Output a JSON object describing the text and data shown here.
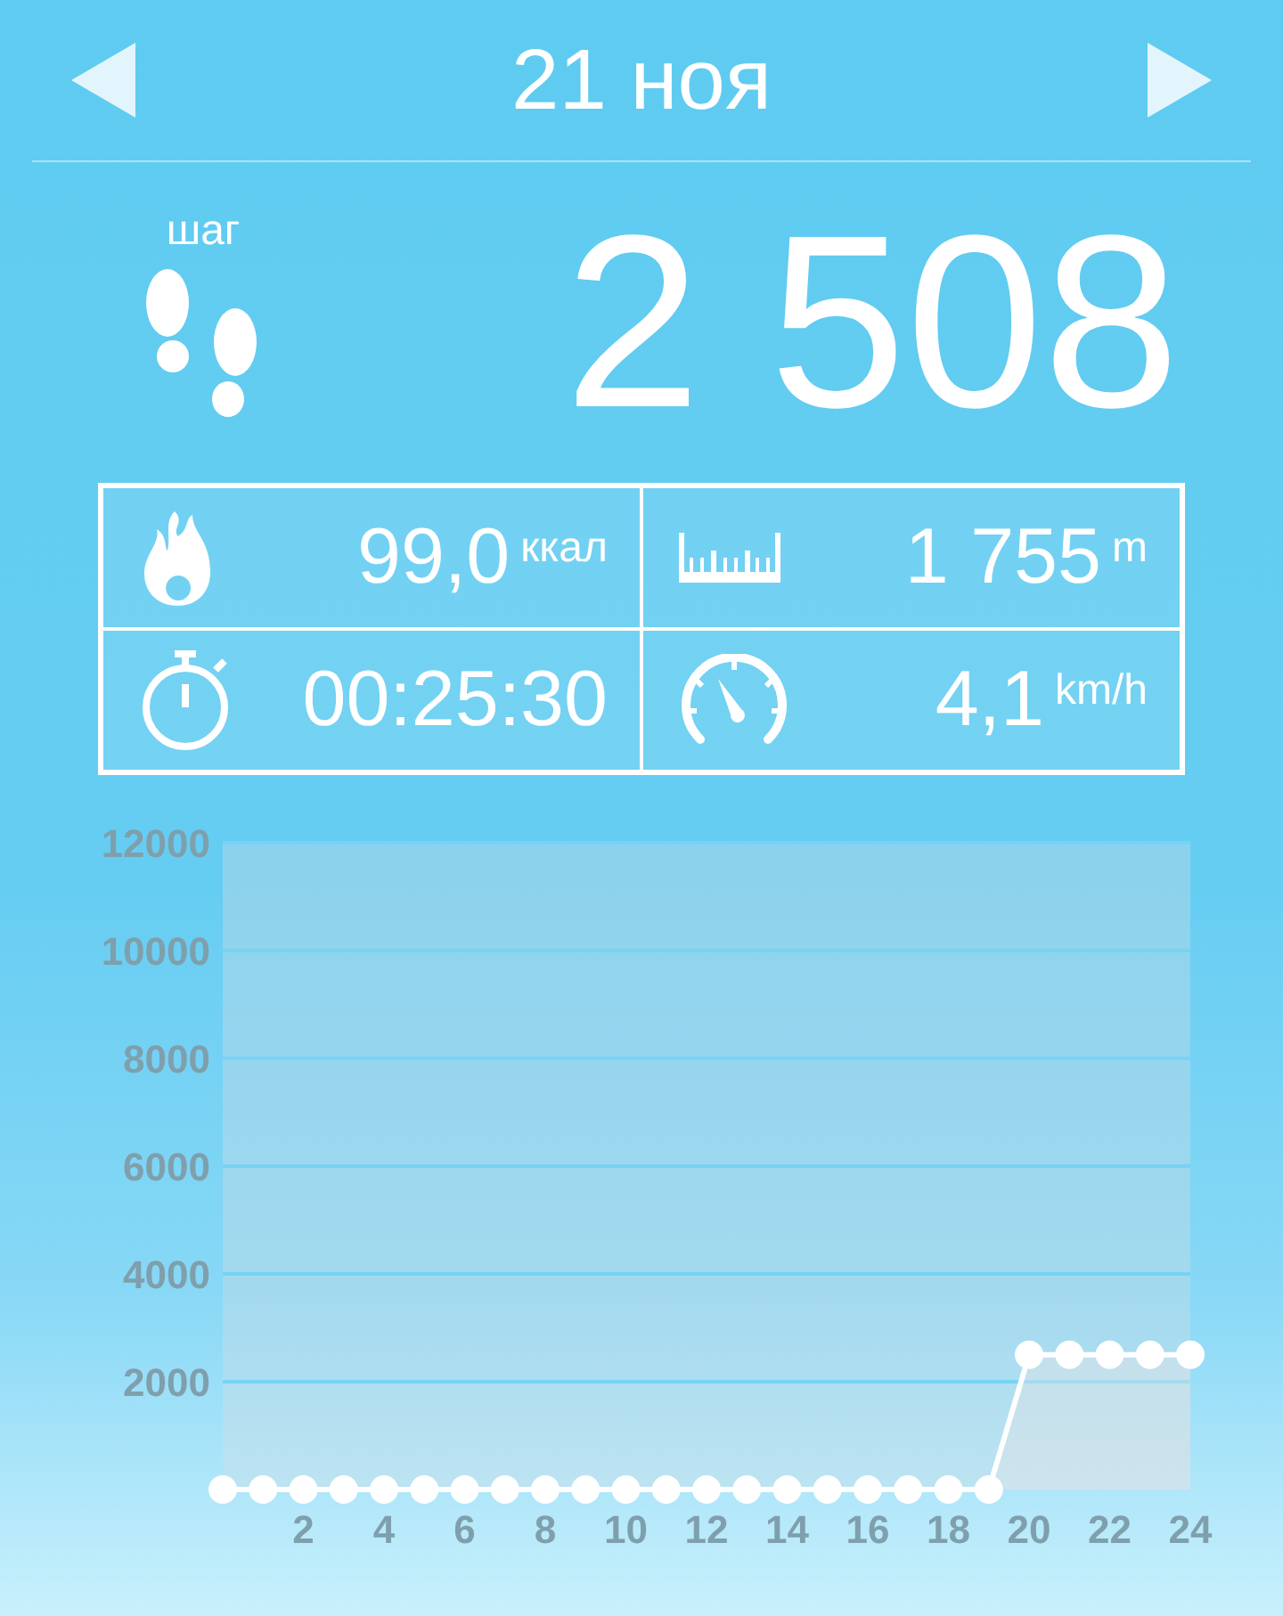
{
  "header": {
    "date": "21 ноя"
  },
  "steps": {
    "label": "шаг",
    "value": "2 508"
  },
  "stats": [
    {
      "kind": "calories",
      "value": "99,0",
      "unit": "ккал"
    },
    {
      "kind": "distance",
      "value": "1 755",
      "unit": "m"
    },
    {
      "kind": "time",
      "value": "00:25:30"
    },
    {
      "kind": "speed",
      "value": "4,1",
      "unit": "km/h"
    }
  ],
  "chart": {
    "chart_data": {
      "type": "line",
      "x": [
        0,
        1,
        2,
        3,
        4,
        5,
        6,
        7,
        8,
        9,
        10,
        11,
        12,
        13,
        14,
        15,
        16,
        17,
        18,
        19,
        20,
        21,
        22,
        23,
        24
      ],
      "xlim": [
        0,
        24
      ],
      "ylim": [
        0,
        12000
      ],
      "grid": true,
      "xticks": [
        2,
        4,
        6,
        8,
        10,
        12,
        14,
        16,
        18,
        20,
        22,
        24
      ],
      "yticks": [
        2000,
        4000,
        6000,
        8000,
        10000,
        12000
      ],
      "series": [
        {
          "color": "#ffffff",
          "marker": "circle",
          "values": [
            0,
            0,
            0,
            0,
            0,
            0,
            0,
            0,
            0,
            0,
            0,
            0,
            0,
            0,
            0,
            0,
            0,
            0,
            0,
            0,
            2500,
            2500,
            2500,
            2500,
            2500
          ]
        }
      ]
    }
  }
}
